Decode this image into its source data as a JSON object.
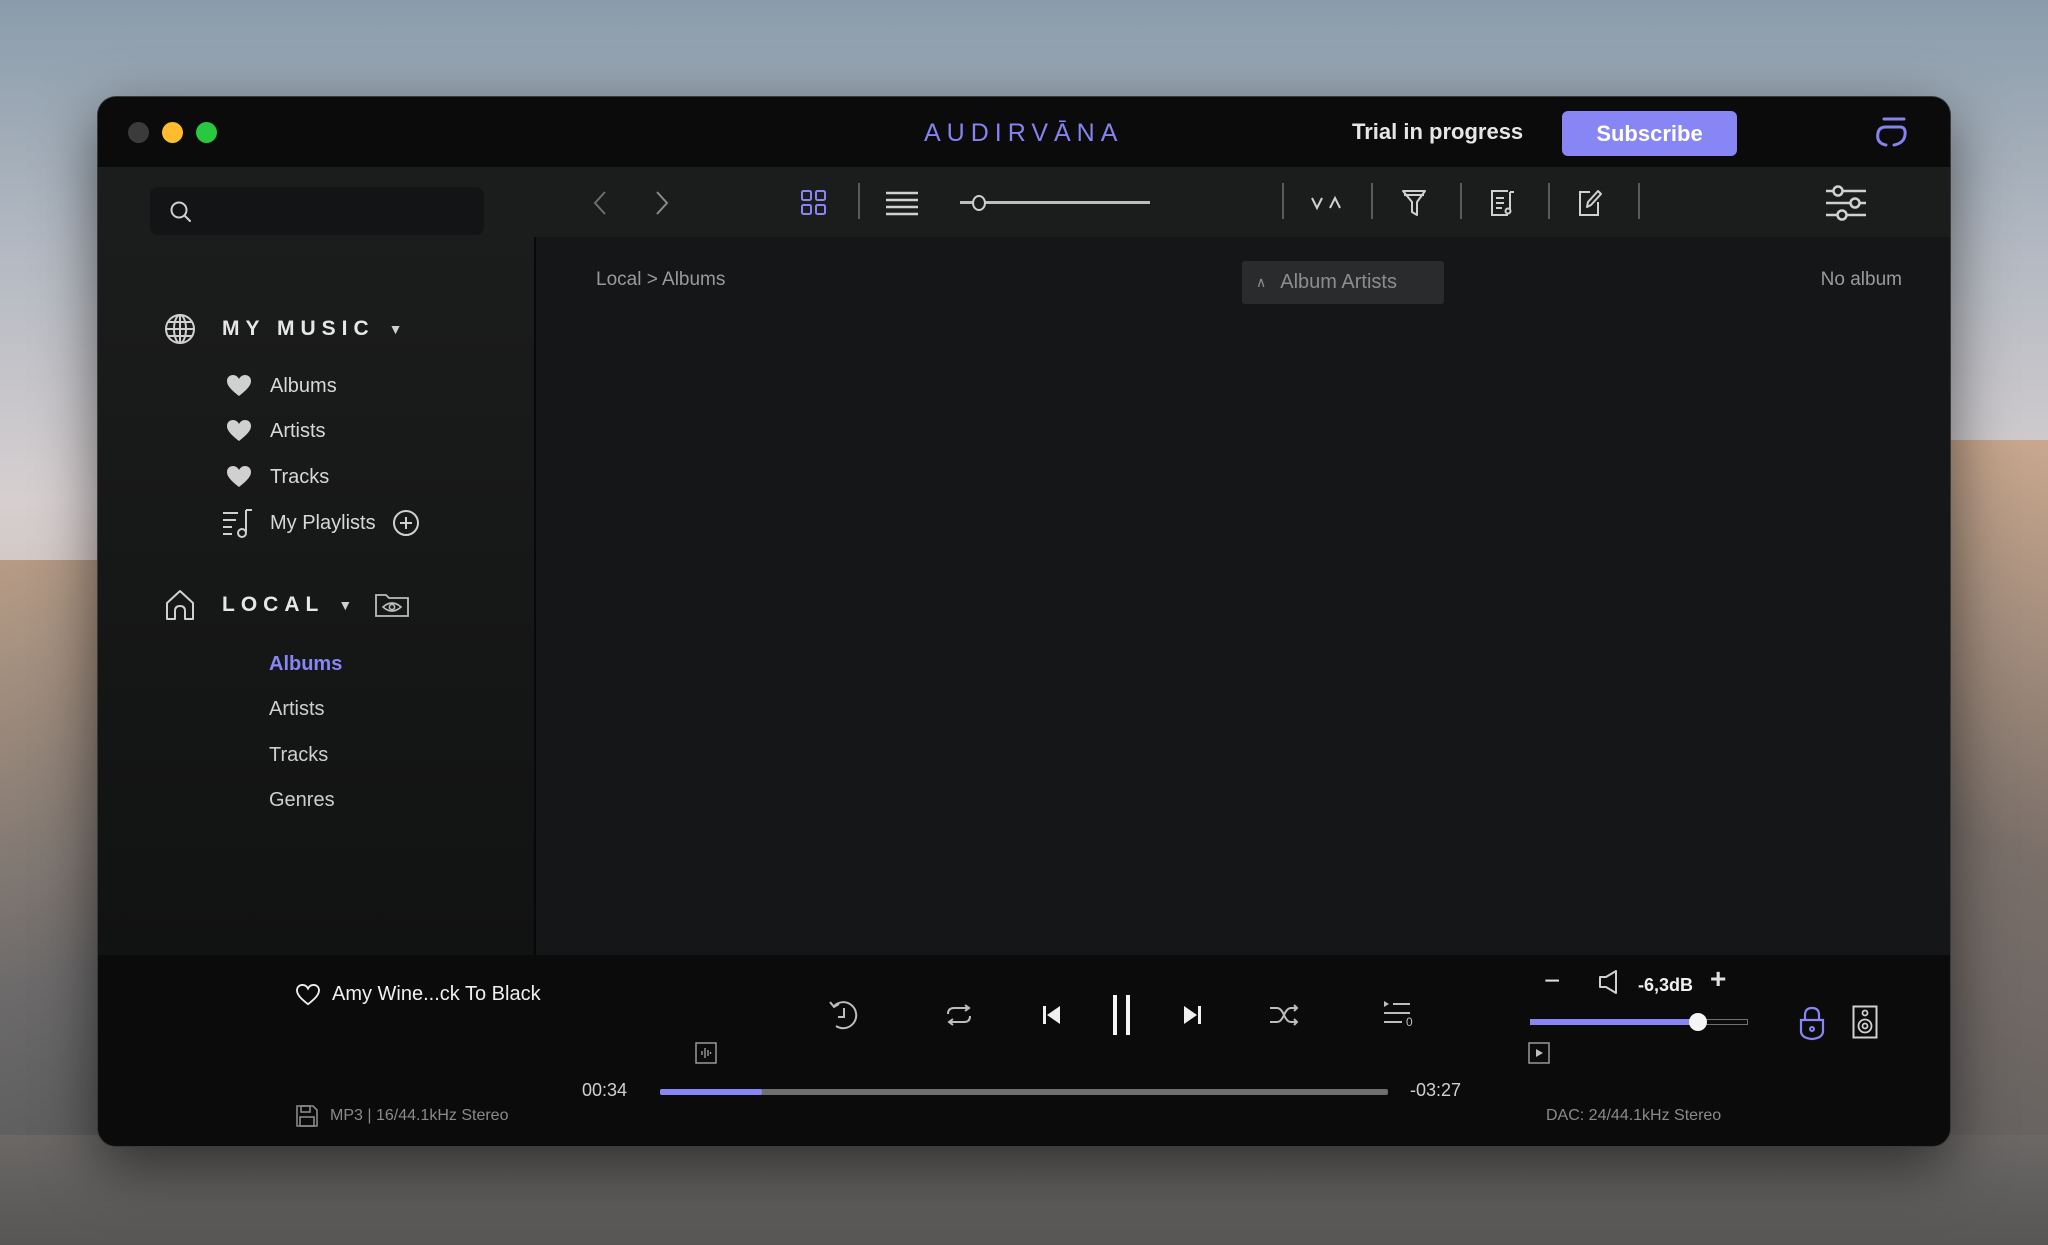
{
  "window": {
    "app_title": "AUDIRVĀNA",
    "trial_status": "Trial in progress",
    "subscribe_label": "Subscribe",
    "accent_color": "#8886f4"
  },
  "toolbar": {
    "search_placeholder": "",
    "sort_label": "∨∧",
    "icons": [
      "back-icon",
      "forward-icon",
      "grid-view-icon",
      "list-view-icon",
      "zoom-slider",
      "sort-icon",
      "filter-icon",
      "playlist-icon",
      "edit-icon",
      "settings-sliders-icon"
    ],
    "zoom_level_fraction": 0.05
  },
  "sidebar": {
    "my_music": {
      "label": "MY MUSIC",
      "items": [
        {
          "label": "Albums",
          "icon": "heart-icon"
        },
        {
          "label": "Artists",
          "icon": "heart-icon"
        },
        {
          "label": "Tracks",
          "icon": "heart-icon"
        },
        {
          "label": "My Playlists",
          "icon": "playlist-icon"
        }
      ]
    },
    "local": {
      "label": "LOCAL",
      "items": [
        {
          "label": "Albums",
          "active": true
        },
        {
          "label": "Artists",
          "active": false
        },
        {
          "label": "Tracks",
          "active": false
        },
        {
          "label": "Genres",
          "active": false
        }
      ]
    }
  },
  "main": {
    "breadcrumb": "Local > Albums",
    "sort_by": "Album Artists",
    "status": "No album"
  },
  "player": {
    "track": "Amy Wine...ck To Black",
    "format": "MP3 | 16/44.1kHz Stereo",
    "elapsed": "00:34",
    "remaining": "-03:27",
    "progress_percent": 14,
    "volume_db": "-6,3dB",
    "volume_fraction": 0.77,
    "dac": "DAC: 24/44.1kHz Stereo",
    "queue_count": "0",
    "minus_label": "−",
    "plus_label": "+"
  }
}
